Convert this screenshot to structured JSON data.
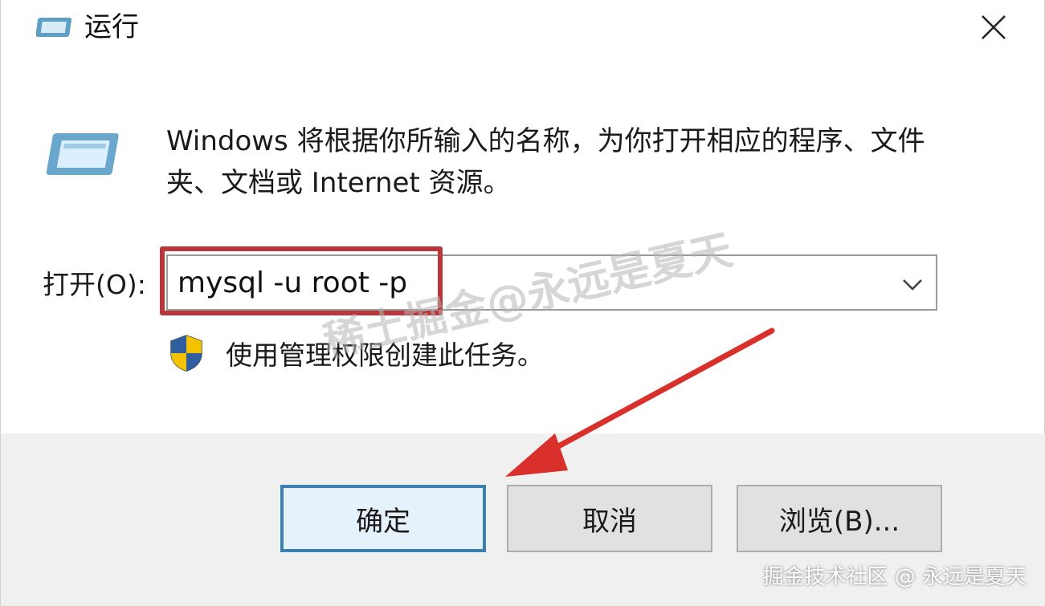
{
  "window": {
    "title": "运行",
    "icons": {
      "title": "run-icon",
      "close": "close-icon"
    }
  },
  "content": {
    "description": "Windows 将根据你所输入的名称，为你打开相应的程序、文件夹、文档或 Internet 资源。",
    "open_label": "打开(O):",
    "command_value": "mysql -u root -p",
    "admin_note": "使用管理权限创建此任务。",
    "icons": {
      "app": "run-app-icon",
      "shield": "uac-shield-icon",
      "dropdown": "chevron-down-icon"
    }
  },
  "buttons": {
    "ok": "确定",
    "cancel": "取消",
    "browse": "浏览(B)..."
  },
  "annotations": {
    "highlight_color": "#b9363a",
    "arrow_color": "#d9302c"
  },
  "watermarks": {
    "center": "稀土掘金@永远是夏天",
    "corner": "掘金技术社区 @ 永远是夏天"
  },
  "colors": {
    "primary_button_border": "#3c7fb1",
    "footer_background": "#f0f0f0"
  }
}
